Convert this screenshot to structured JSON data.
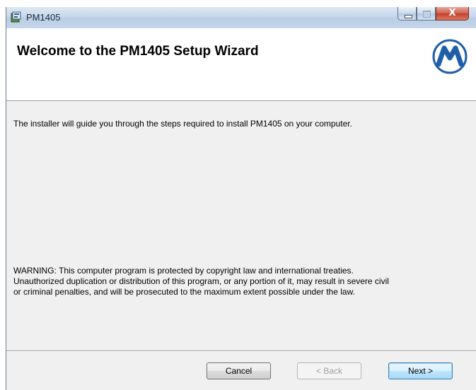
{
  "window": {
    "title": "PM1405"
  },
  "titlebar": {
    "icons": [
      "installer-app-icon",
      "minimize-icon",
      "maximize-icon",
      "close-icon"
    ],
    "close_glyph": "X"
  },
  "banner": {
    "title": "Welcome to the PM1405 Setup Wizard",
    "logo_icon": "brand-m-logo"
  },
  "body": {
    "intro": "The installer will guide you through the steps required to install PM1405 on your computer.",
    "warning_lines": [
      "WARNING: This computer program is protected by copyright law and international treaties.",
      "Unauthorized duplication or distribution of this program, or any portion of it, may result in severe civil",
      "or criminal penalties, and will be prosecuted to the maximum extent possible under the law."
    ]
  },
  "buttons": {
    "cancel": "Cancel",
    "back": "< Back",
    "next": "Next >"
  },
  "colors": {
    "brand_blue": "#1f5ea8",
    "dialog_bg": "#f0f0f0",
    "close_red": "#c4402b"
  }
}
